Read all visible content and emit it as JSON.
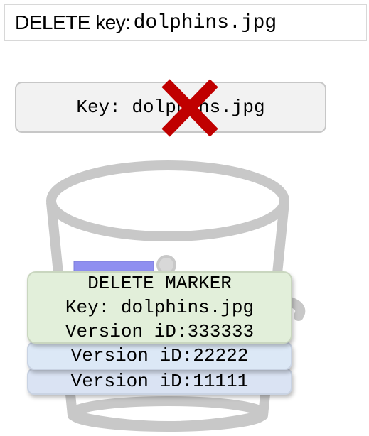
{
  "title": {
    "label": "DELETE key:",
    "key": "dolphins.jpg"
  },
  "key_box": {
    "text": "Key: dolphins.jpg"
  },
  "delete_marker": {
    "line1": "DELETE MARKER",
    "line2": "Key: dolphins.jpg",
    "line3": "Version iD:333333"
  },
  "versions": [
    "Version iD:22222",
    "Version iD:11111"
  ],
  "colors": {
    "x_mark": "#c00000",
    "bucket": "#c8c8c8",
    "marker_fill": "#e2efda",
    "version_fill": "#dae3f3",
    "object_tab": "#8f8ff0"
  }
}
